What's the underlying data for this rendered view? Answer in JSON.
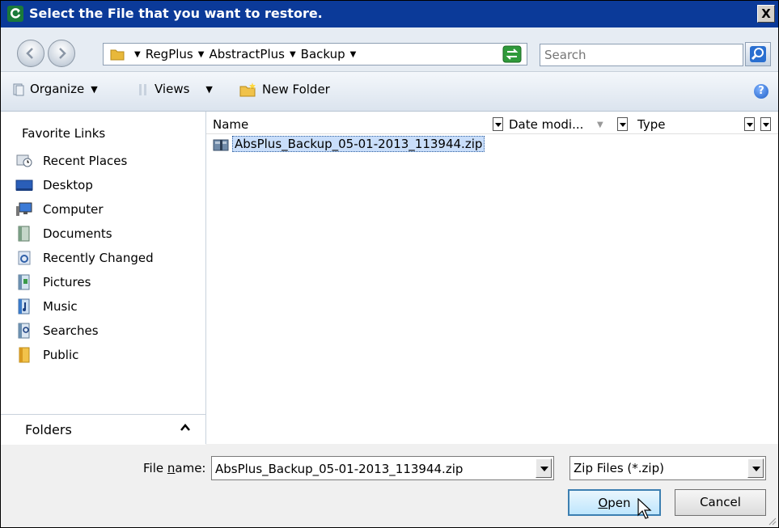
{
  "window": {
    "title": "Select the File that you want to restore.",
    "close_glyph": "X"
  },
  "address": {
    "crumbs": [
      "RegPlus",
      "AbstractPlus",
      "Backup"
    ],
    "search_placeholder": "Search"
  },
  "toolbar": {
    "organize": "Organize",
    "views": "Views",
    "new_folder": "New Folder",
    "help_glyph": "?"
  },
  "sidebar": {
    "heading": "Favorite Links",
    "items": [
      {
        "label": "Recent Places",
        "icon": "recent-places-icon"
      },
      {
        "label": "Desktop",
        "icon": "desktop-icon"
      },
      {
        "label": "Computer",
        "icon": "computer-icon"
      },
      {
        "label": "Documents",
        "icon": "documents-icon"
      },
      {
        "label": "Recently Changed",
        "icon": "recently-changed-icon"
      },
      {
        "label": "Pictures",
        "icon": "pictures-icon"
      },
      {
        "label": "Music",
        "icon": "music-icon"
      },
      {
        "label": "Searches",
        "icon": "searches-icon"
      },
      {
        "label": "Public",
        "icon": "public-folder-icon"
      }
    ],
    "folders_label": "Folders"
  },
  "filelist": {
    "columns": {
      "name": "Name",
      "date": "Date modi...",
      "type": "Type"
    },
    "files": [
      {
        "name": "AbsPlus_Backup_05-01-2013_113944.zip",
        "selected": true
      }
    ]
  },
  "bottom": {
    "filename_label_pre": "File ",
    "filename_label_ul": "n",
    "filename_label_post": "ame:",
    "filename_value": "AbsPlus_Backup_05-01-2013_113944.zip",
    "filetype_value": "Zip Files (*.zip)",
    "open_ul": "O",
    "open_rest": "pen",
    "cancel": "Cancel"
  },
  "colors": {
    "titlebar": "#0b3a99",
    "selection": "#c9defa"
  }
}
